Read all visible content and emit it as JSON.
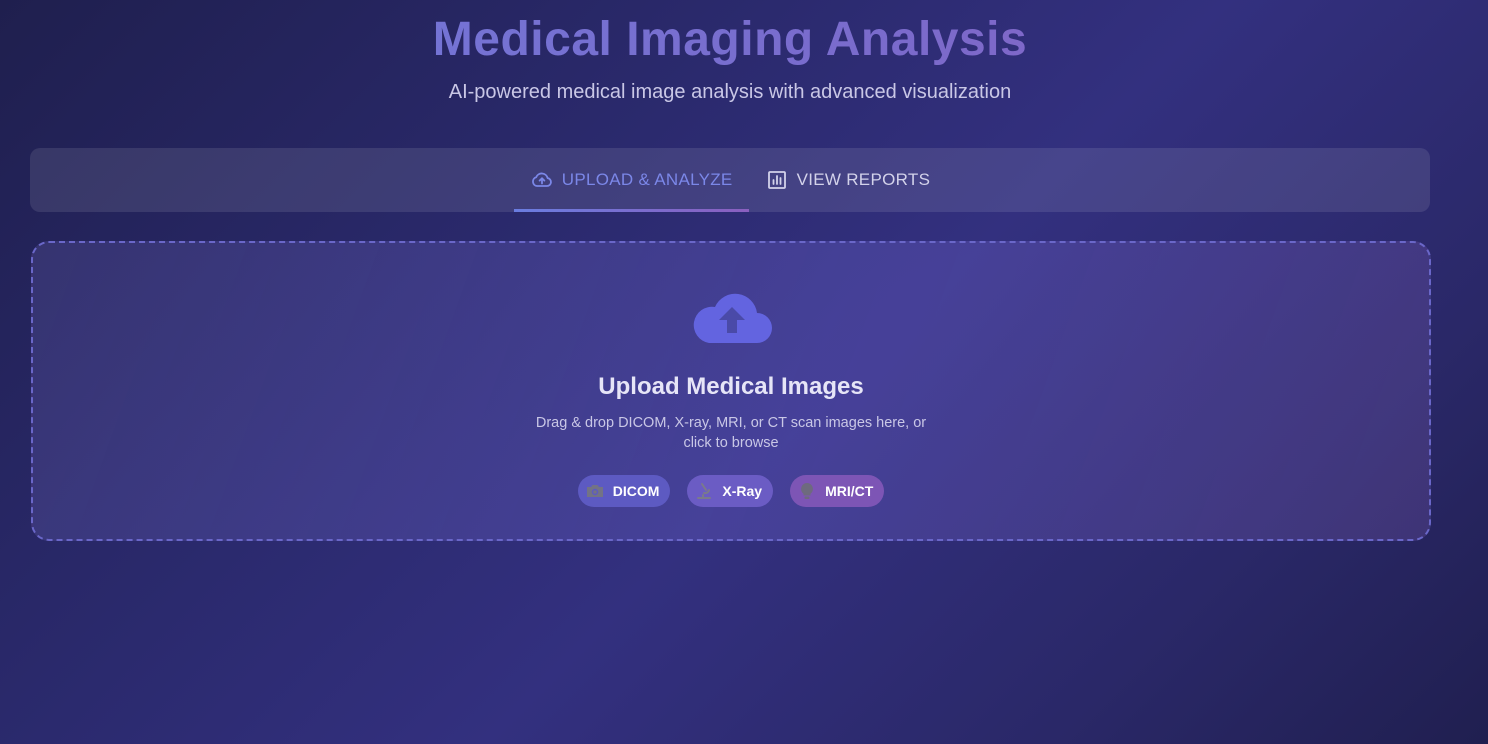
{
  "header": {
    "title": "Medical Imaging Analysis",
    "subtitle": "AI-powered medical image analysis with advanced visualization"
  },
  "tabs": [
    {
      "label": "UPLOAD & ANALYZE",
      "icon": "cloud-upload-icon",
      "active": true
    },
    {
      "label": "VIEW REPORTS",
      "icon": "bar-chart-icon",
      "active": false
    }
  ],
  "upload": {
    "icon": "cloud-upload-icon",
    "title": "Upload Medical Images",
    "description": "Drag & drop DICOM, X-ray, MRI, or CT scan images here, or click to browse",
    "formats": [
      {
        "label": "DICOM",
        "icon": "camera-icon"
      },
      {
        "label": "X-Ray",
        "icon": "microscope-icon"
      },
      {
        "label": "MRI/CT",
        "icon": "lightbulb-icon"
      }
    ]
  },
  "colors": {
    "accent": "#7b87e8",
    "upload_icon": "#6364e0",
    "chip_dicom": "#5d5ac2",
    "chip_xray": "#6b5cc4",
    "chip_mri": "#7d55b5"
  }
}
